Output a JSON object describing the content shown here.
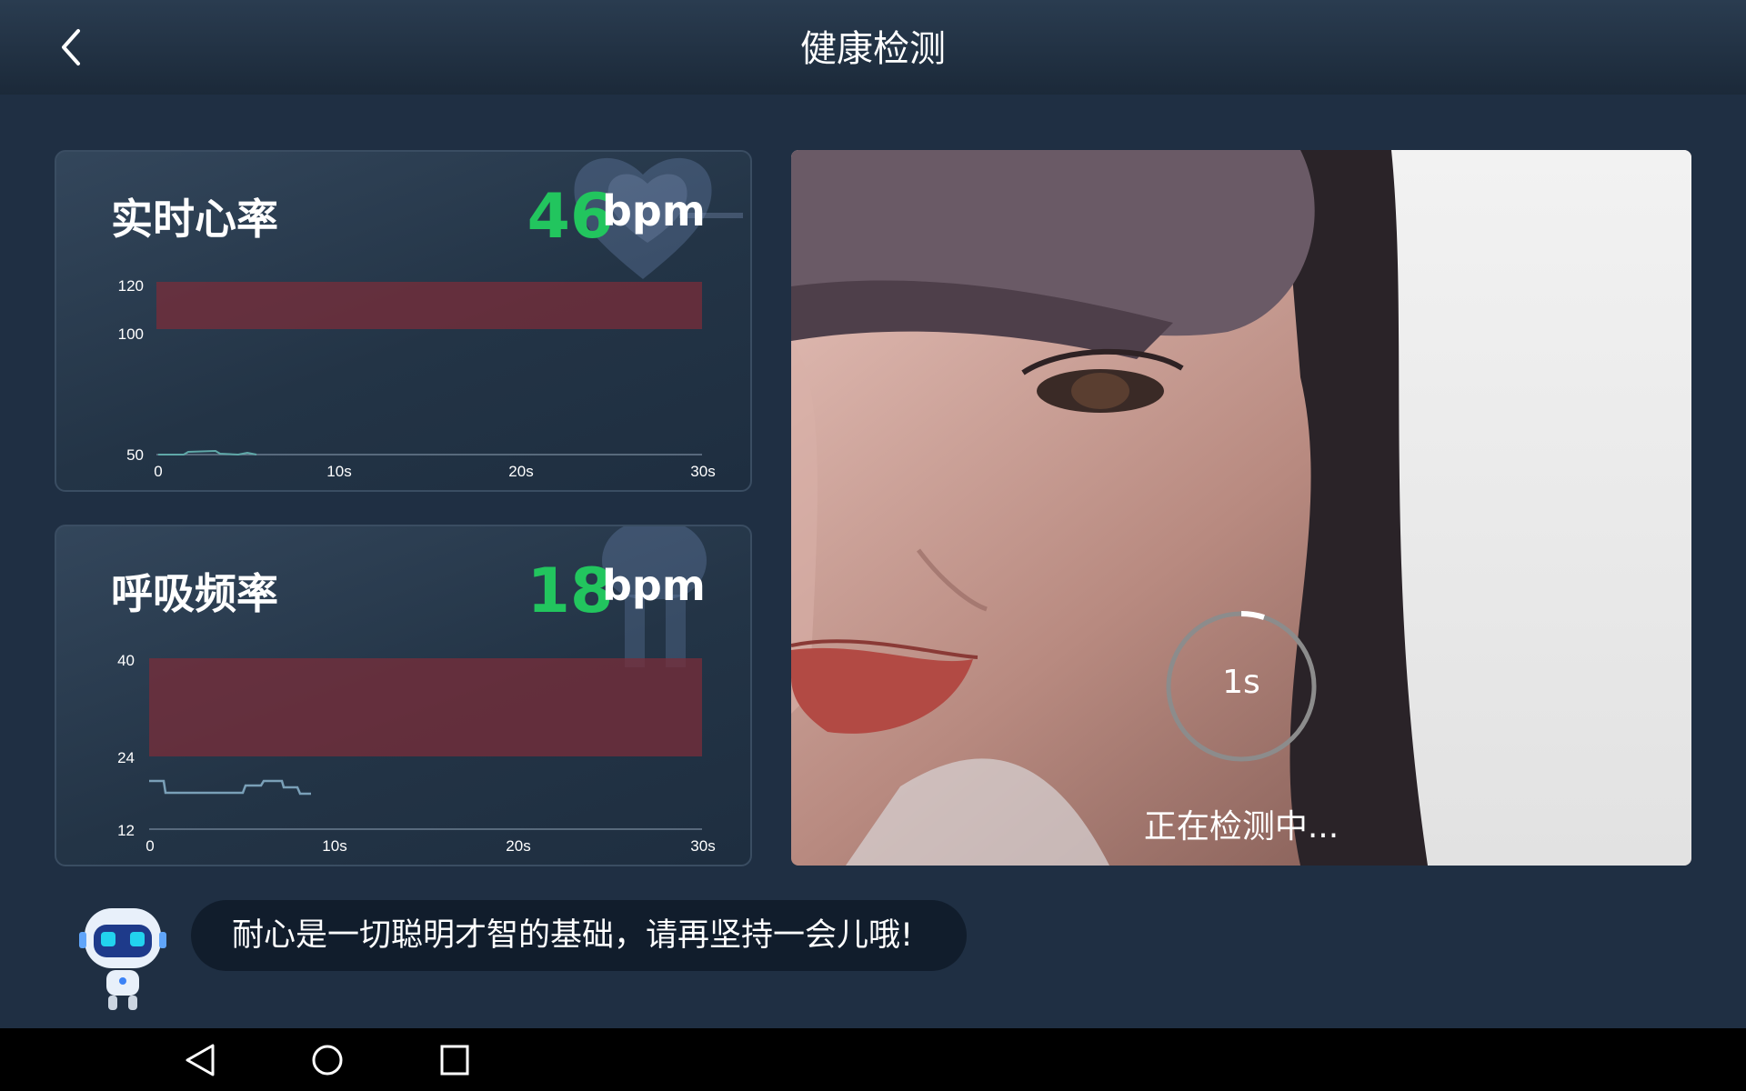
{
  "header": {
    "title": "健康检测",
    "back_icon": "chevron-left-icon"
  },
  "heart_rate": {
    "title": "实时心率",
    "value": "46",
    "unit": "bpm",
    "value_color": "#22c55e",
    "icon": "heart-icon",
    "y_ticks": [
      "120",
      "100",
      "50"
    ],
    "x_ticks": [
      "0",
      "10s",
      "20s",
      "30s"
    ]
  },
  "respiration": {
    "title": "呼吸频率",
    "value": "18",
    "unit": "bpm",
    "value_color": "#22c55e",
    "icon": "lungs-icon",
    "y_ticks": [
      "40",
      "24",
      "12"
    ],
    "x_ticks": [
      "0",
      "10s",
      "20s",
      "30s"
    ]
  },
  "camera": {
    "timer": "1s",
    "timer_progress": 0.05,
    "status": "正在检测中..."
  },
  "assistant": {
    "message": "耐心是一切聪明才智的基础，请再坚持一会儿哦!",
    "avatar_icon": "robot-icon"
  },
  "system_nav": {
    "back_icon": "triangle-back-icon",
    "home_icon": "circle-home-icon",
    "recents_icon": "square-recents-icon"
  }
}
